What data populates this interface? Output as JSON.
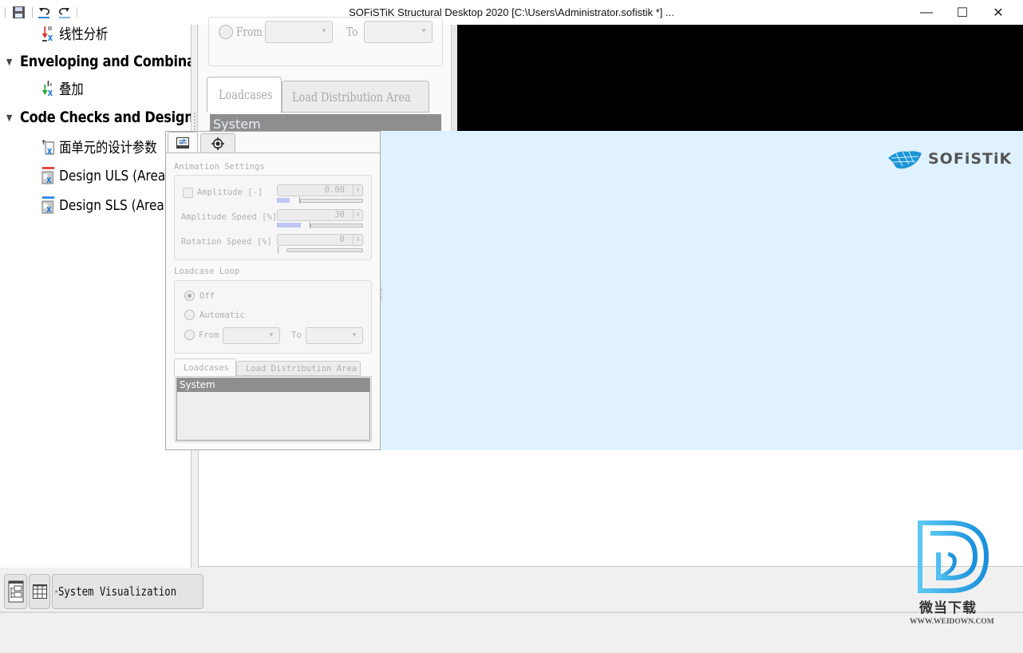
{
  "window": {
    "title": "SOFiSTiK Structural Desktop 2020  [C:\\Users\\Administrator.sofistik *] ...",
    "quick_access": [
      {
        "icon": "save-icon"
      },
      {
        "icon": "undo-icon"
      },
      {
        "icon": "redo-icon"
      }
    ],
    "controls": {
      "minimize": "—",
      "maximize": "☐",
      "close": "✕"
    }
  },
  "tree": {
    "items": [
      {
        "type": "item",
        "label": "线性分析",
        "icon": "linear-analysis-icon"
      },
      {
        "type": "group",
        "label": "Enveloping and Combina...",
        "expanded": true
      },
      {
        "type": "item",
        "label": "叠加",
        "icon": "superposition-icon"
      },
      {
        "type": "group",
        "label": "Code Checks and Design ...",
        "expanded": true
      },
      {
        "type": "item",
        "label": "面单元的设计参数",
        "icon": "design-parameters-icon"
      },
      {
        "type": "item",
        "label": "Design ULS (Area e",
        "icon": "design-uls-icon"
      },
      {
        "type": "item",
        "label": "Design SLS (Area e",
        "icon": "design-sls-icon"
      }
    ]
  },
  "background_panel": {
    "from_label": "From",
    "to_label": "To",
    "tabs": [
      "Loadcases",
      "Load Distribution Area"
    ],
    "list_item": "System"
  },
  "panel": {
    "tabs": [
      {
        "icon": "settings-sliders-icon",
        "active": true
      },
      {
        "icon": "target-crosshair-icon",
        "active": false
      }
    ],
    "animation_settings": {
      "title": "Animation Settings",
      "amplitude": {
        "label": "Amplitude [-]",
        "checked": false,
        "value": "0.00",
        "slider_fraction": 0.06
      },
      "amplitude_speed": {
        "label": "Amplitude Speed [%]",
        "value": "30",
        "slider_fraction": 0.3
      },
      "rotation_speed": {
        "label": "Rotation Speed [%]",
        "value": "0",
        "slider_fraction": 0.0
      }
    },
    "loadcase_loop": {
      "title": "Loadcase Loop",
      "options": [
        {
          "label": "Off",
          "selected": true
        },
        {
          "label": "Automatic",
          "selected": false
        },
        {
          "label": "From",
          "selected": false
        }
      ],
      "to_label": "To",
      "from_value": "",
      "to_value": ""
    },
    "list_tabs": [
      {
        "label": "Loadcases",
        "active": true
      },
      {
        "label": "Load Distribution Area",
        "active": false
      }
    ],
    "list_items": [
      "System"
    ]
  },
  "viewport": {
    "brand_logo": "SOFiSTiK",
    "background_color": "#dff2fd"
  },
  "bottom_tabs": [
    {
      "icon": "tree-view-icon",
      "label": ""
    },
    {
      "icon": "grid-table-icon",
      "label": ""
    },
    {
      "icon": "system-visualization-icon",
      "label": "System Visualization"
    }
  ],
  "watermark": {
    "title": "微当下载",
    "url": "WWW.WEIDOWN.COM"
  }
}
